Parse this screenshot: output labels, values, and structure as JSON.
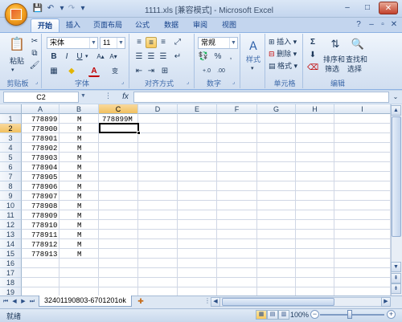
{
  "window": {
    "title": "1111.xls  [兼容模式] - Microsoft Excel",
    "minimize": "–",
    "restore": "□",
    "close": "✕"
  },
  "quick_access": {
    "save": "💾",
    "undo": "↶",
    "redo": "↷",
    "customize": "▾"
  },
  "tabs": [
    {
      "label": "开始",
      "active": true
    },
    {
      "label": "插入"
    },
    {
      "label": "页面布局"
    },
    {
      "label": "公式"
    },
    {
      "label": "数据"
    },
    {
      "label": "审阅"
    },
    {
      "label": "视图"
    }
  ],
  "ribbon": {
    "clipboard": {
      "label": "剪贴板",
      "paste": "粘贴"
    },
    "font": {
      "label": "字体",
      "name": "宋体",
      "size": "11",
      "bold": "B",
      "italic": "I",
      "underline": "U",
      "grow": "A▴",
      "shrink": "A▾",
      "font_color_letter": "A",
      "special": "变"
    },
    "alignment": {
      "label": "对齐方式"
    },
    "number": {
      "label": "数字",
      "format": "常规",
      "percent": "%",
      "comma": ",",
      "increase_decimal": "+.0",
      "decrease_decimal": ".00"
    },
    "styles": {
      "label": "样式"
    },
    "cells": {
      "label": "单元格",
      "insert": "插入",
      "delete": "删除",
      "format": "格式"
    },
    "editing": {
      "label": "编辑",
      "sigma": "Σ",
      "sort": "排序和",
      "sort2": "筛选",
      "find": "查找和",
      "find2": "选择"
    }
  },
  "formula_bar": {
    "name_box": "C2",
    "fx": "fx",
    "formula": ""
  },
  "columns": [
    "A",
    "B",
    "C",
    "D",
    "E",
    "F",
    "G",
    "H",
    "I"
  ],
  "rows": [
    {
      "num": "1",
      "a": "778899",
      "b": "M",
      "c": "778899M"
    },
    {
      "num": "2",
      "a": "778900",
      "b": "M",
      "c": ""
    },
    {
      "num": "3",
      "a": "778901",
      "b": "M",
      "c": ""
    },
    {
      "num": "4",
      "a": "778902",
      "b": "M",
      "c": ""
    },
    {
      "num": "5",
      "a": "778903",
      "b": "M",
      "c": ""
    },
    {
      "num": "6",
      "a": "778904",
      "b": "M",
      "c": ""
    },
    {
      "num": "7",
      "a": "778905",
      "b": "M",
      "c": ""
    },
    {
      "num": "8",
      "a": "778906",
      "b": "M",
      "c": ""
    },
    {
      "num": "9",
      "a": "778907",
      "b": "M",
      "c": ""
    },
    {
      "num": "10",
      "a": "778908",
      "b": "M",
      "c": ""
    },
    {
      "num": "11",
      "a": "778909",
      "b": "M",
      "c": ""
    },
    {
      "num": "12",
      "a": "778910",
      "b": "M",
      "c": ""
    },
    {
      "num": "13",
      "a": "778911",
      "b": "M",
      "c": ""
    },
    {
      "num": "14",
      "a": "778912",
      "b": "M",
      "c": ""
    },
    {
      "num": "15",
      "a": "778913",
      "b": "M",
      "c": ""
    },
    {
      "num": "16",
      "a": "",
      "b": "",
      "c": ""
    },
    {
      "num": "17",
      "a": "",
      "b": "",
      "c": ""
    },
    {
      "num": "18",
      "a": "",
      "b": "",
      "c": ""
    },
    {
      "num": "19",
      "a": "",
      "b": "",
      "c": ""
    }
  ],
  "sheet_tab": "32401190803-6701201ok",
  "status": {
    "ready": "就绪",
    "zoom": "100%",
    "zoom_level": 1.0
  },
  "colors": {
    "accent": "#15428b",
    "selected_header": "#f1c15f",
    "ribbon_bg": "#dce7f5"
  }
}
